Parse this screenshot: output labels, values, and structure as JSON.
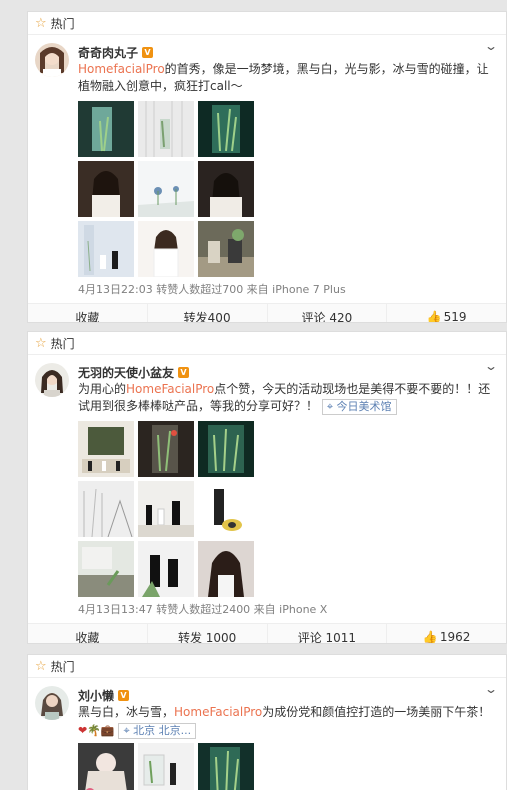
{
  "posts": [
    {
      "hot_label": "热门",
      "name": "奇奇肉丸子",
      "text_link": "HomefacialPro",
      "text_rest": "的首秀，像是一场梦境，黑与白，光与影，冰与雪的碰撞，让植物融入创意中，疯狂打call～",
      "meta": "4月13日22:03 转赞人数超过700 来自 iPhone 7 Plus",
      "actions": {
        "collect": "收藏",
        "repost": "转发400",
        "comment": "评论 420",
        "like": "519"
      }
    },
    {
      "hot_label": "热门",
      "name": "无羽的天使小盆友",
      "text_pre": "为用心的",
      "text_link": "HomeFacialPro",
      "text_rest": "点个赞，今天的活动现场也是美得不要不要的！！还试用到很多棒棒哒产品，等我的分享可好？！",
      "location": "今日美术馆",
      "meta": "4月13日13:47 转赞人数超过2400 来自 iPhone X",
      "actions": {
        "collect": "收藏",
        "repost": "转发 1000",
        "comment": "评论 1011",
        "like": "1962"
      }
    },
    {
      "hot_label": "热门",
      "name": "刘小懒",
      "text_pre": "黑与白，冰与雪，",
      "text_link": "HomeFacialPro",
      "text_rest": "为成份党和颜值控打造的一场美丽下午茶！",
      "location": "北京 北京...",
      "emoji": "❤🌴💼"
    }
  ],
  "colors": {
    "link": "#eb7350",
    "star": "#e6a23c",
    "badge": "#f09211"
  }
}
